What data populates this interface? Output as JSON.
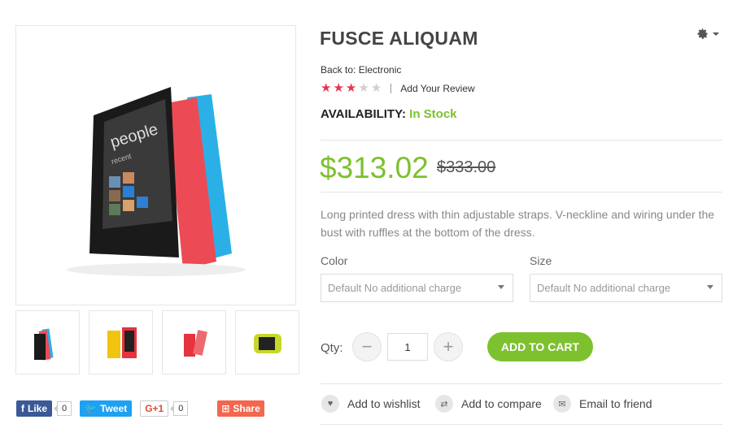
{
  "product": {
    "title": "FUSCE ALIQUAM",
    "back_to": "Back to: Electronic",
    "rating": {
      "value": 3,
      "max": 5
    },
    "review_link": "Add Your Review",
    "availability_label": "AVAILABILITY:",
    "availability_value": "In Stock",
    "price": "$313.02",
    "old_price": "$333.00",
    "description": "Long printed dress with thin adjustable straps. V-neckline and wiring under the bust with ruffles at the bottom of the dress."
  },
  "options": {
    "color_label": "Color",
    "color_value": "Default No additional charge",
    "size_label": "Size",
    "size_value": "Default No additional charge"
  },
  "purchase": {
    "qty_label": "Qty:",
    "qty_value": "1",
    "minus": "−",
    "plus": "+",
    "add_to_cart": "ADD TO CART"
  },
  "actions": {
    "wishlist": "Add to wishlist",
    "compare": "Add to compare",
    "email": "Email to friend"
  },
  "social": {
    "facebook": "Like",
    "facebook_count": "0",
    "twitter": "Tweet",
    "gplus": "G+1",
    "gplus_count": "0",
    "share": "Share"
  },
  "colors": {
    "accent_green": "#7dc12f",
    "star_red": "#e8344e",
    "facebook": "#3b5998",
    "twitter": "#1da1f2",
    "share": "#f4664d"
  }
}
